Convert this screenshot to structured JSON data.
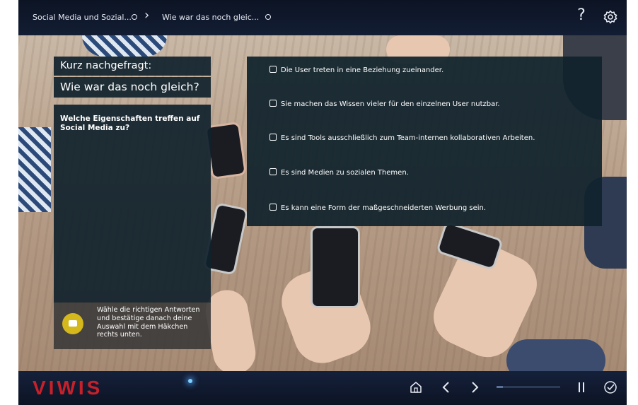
{
  "breadcrumb": {
    "item1": "Social Media und Sozial...",
    "item2": "Wie war das noch gleic..."
  },
  "header": {
    "help_label": "?",
    "icons": [
      "help-icon",
      "gear-icon"
    ]
  },
  "question_panel": {
    "heading_line1": "Kurz nachgefragt:",
    "heading_line2": "Wie war das noch gleich?",
    "question": "Welche Eigenschaften treffen auf Social Media zu?",
    "hint": "Wähle die richtigen Antworten und bestätige danach deine Auswahl mit dem Häkchen rechts unten."
  },
  "answers": [
    {
      "label": "Die User treten in eine Beziehung zueinander.",
      "checked": false
    },
    {
      "label": "Sie machen das Wissen vieler für den einzelnen User nutzbar.",
      "checked": false
    },
    {
      "label": "Es sind Tools ausschließlich zum Team-internen kollaborativen Arbeiten.",
      "checked": false
    },
    {
      "label": "Es sind Medien zu sozialen Themen.",
      "checked": false
    },
    {
      "label": "Es kann eine Form der maßgeschneiderten Werbung sein.",
      "checked": false
    }
  ],
  "footer": {
    "logo": "VIWIS",
    "progress": 0.1,
    "icons": [
      "home-icon",
      "previous-icon",
      "next-icon",
      "pause-icon",
      "confirm-check-icon"
    ]
  },
  "colors": {
    "panel": "#10222c",
    "accent_logo": "#c8202a",
    "hint_bubble": "#d4b81c"
  }
}
